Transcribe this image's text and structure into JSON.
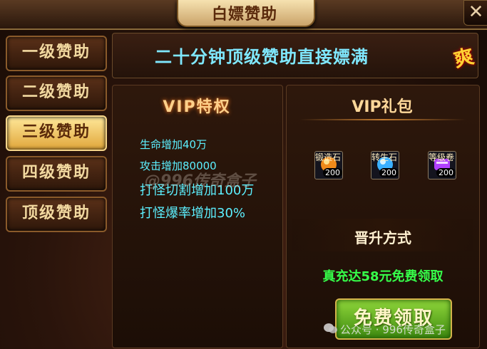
{
  "window": {
    "title": "白嫖赞助",
    "close": "✕"
  },
  "sidebar": {
    "items": [
      {
        "label": "一级赞助",
        "active": false
      },
      {
        "label": "二级赞助",
        "active": false
      },
      {
        "label": "三级赞助",
        "active": true
      },
      {
        "label": "四级赞助",
        "active": false
      },
      {
        "label": "顶级赞助",
        "active": false
      }
    ]
  },
  "banner": {
    "text": "二十分钟顶级赞助直接嫖满",
    "badge": "爽"
  },
  "vip_privileges": {
    "title": "VIP特权",
    "items": [
      "生命增加40万",
      "攻击增加80000",
      "打怪切割增加100万",
      "打怪爆率增加30%"
    ]
  },
  "vip_gift": {
    "title": "VIP礼包",
    "items": [
      {
        "name": "锻造石",
        "count": "200",
        "icon": "forge-stone-icon",
        "color": "#f08a1a"
      },
      {
        "name": "转生石",
        "count": "200",
        "icon": "rebirth-stone-icon",
        "color": "#3ab0ff"
      },
      {
        "name": "等级卷",
        "count": "200",
        "icon": "level-scroll-icon",
        "color": "#b040ff"
      }
    ],
    "upgrade_label": "晋升方式",
    "requirement": "真充达58元免费领取",
    "claim_button": "免费领取"
  },
  "watermarks": {
    "center": "@996传奇盒子",
    "bottom": "公众号 · 996传奇盒子"
  }
}
